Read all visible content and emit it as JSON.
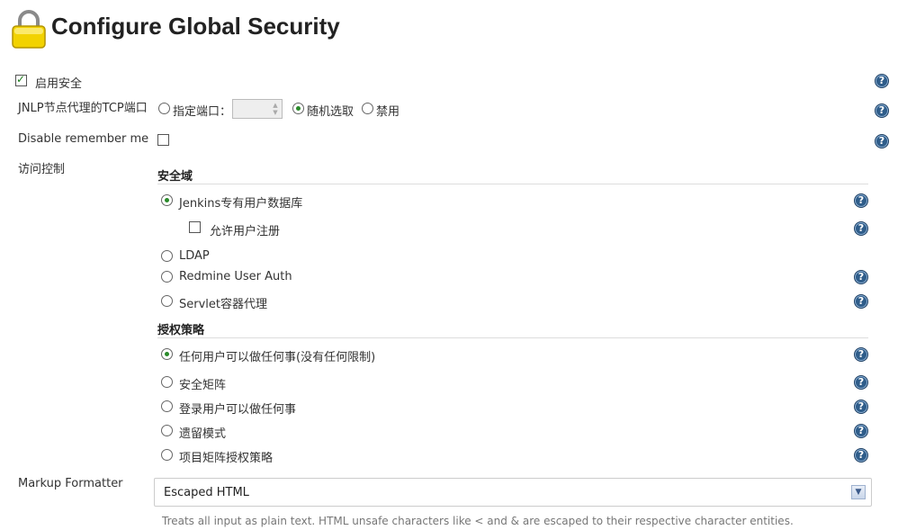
{
  "header": {
    "title": "Configure Global Security",
    "icon": "lock-icon"
  },
  "enable_security": {
    "label": "启用安全",
    "checked": true
  },
  "jnlp": {
    "label": "JNLP节点代理的TCP端口",
    "options": [
      "指定端口：",
      "随机选取",
      "禁用"
    ],
    "selected": "随机选取",
    "port_value": ""
  },
  "remember_me": {
    "label": "Disable remember me",
    "checked": false
  },
  "access_control": {
    "label": "访问控制",
    "realm": {
      "heading": "安全域",
      "options": [
        "Jenkins专有用户数据库",
        "LDAP",
        "Redmine User Auth",
        "Servlet容器代理"
      ],
      "selected": "Jenkins专有用户数据库",
      "allow_signup": {
        "label": "允许用户注册",
        "checked": false
      }
    },
    "authorization": {
      "heading": "授权策略",
      "options": [
        "任何用户可以做任何事(没有任何限制)",
        "安全矩阵",
        "登录用户可以做任何事",
        "遗留模式",
        "项目矩阵授权策略"
      ],
      "selected": "任何用户可以做任何事(没有任何限制)"
    }
  },
  "markup": {
    "label": "Markup Formatter",
    "selected": "Escaped HTML",
    "hint": "Treats all input as plain text. HTML unsafe characters like < and & are escaped to their respective character entities."
  },
  "help_glyph": "?",
  "colors": {
    "help_icon": "#2f5d8a",
    "radio_selected": "#2a8a2a",
    "lock": "#e8c600"
  }
}
